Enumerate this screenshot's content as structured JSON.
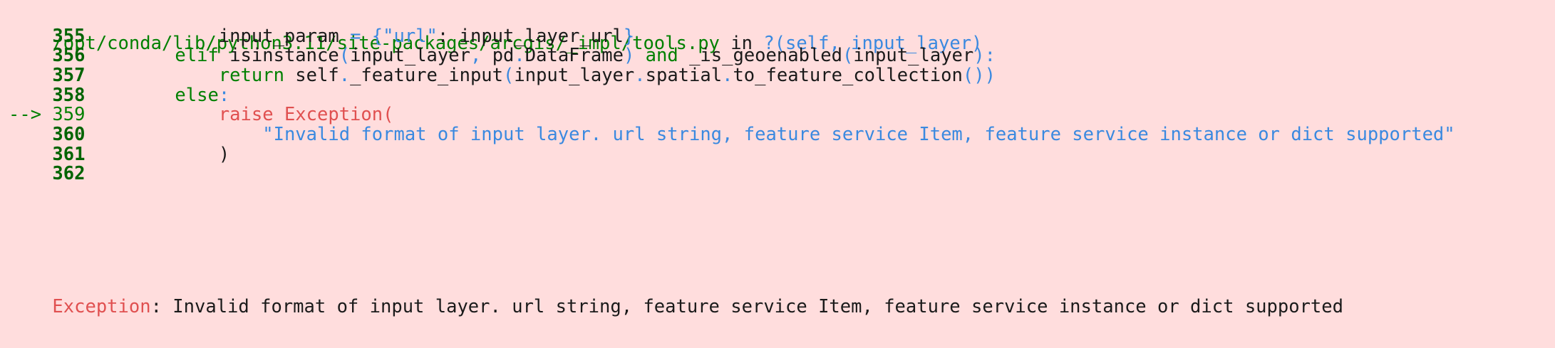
{
  "colors": {
    "background": "#ffdddd",
    "path": "#008000",
    "line_number": "#006400",
    "keyword": "#008000",
    "operator": "#3a89e0",
    "string": "#3a89e0",
    "error": "#e05050",
    "text": "#1a1a1a"
  },
  "header": {
    "path": "/opt/conda/lib/python3.11/site-packages/arcgis/_impl/tools.py",
    "in_word": " in ",
    "func_q": "?",
    "func_args": "(self, input_layer)"
  },
  "lines": [
    {
      "num": "355",
      "arrow": "",
      "indent": "        ",
      "segments": [
        {
          "t": "input_param ",
          "c": "text"
        },
        {
          "t": "=",
          "c": "operator"
        },
        {
          "t": " ",
          "c": "text"
        },
        {
          "t": "{",
          "c": "operator"
        },
        {
          "t": "\"url\"",
          "c": "string"
        },
        {
          "t": ": input_layer_url",
          "c": "text"
        },
        {
          "t": "}",
          "c": "operator"
        }
      ]
    },
    {
      "num": "356",
      "arrow": "",
      "indent": "    ",
      "segments": [
        {
          "t": "elif",
          "c": "keyword"
        },
        {
          "t": " isinstance",
          "c": "text"
        },
        {
          "t": "(",
          "c": "operator"
        },
        {
          "t": "input_layer",
          "c": "text"
        },
        {
          "t": ",",
          "c": "operator"
        },
        {
          "t": " pd",
          "c": "text"
        },
        {
          "t": ".",
          "c": "operator"
        },
        {
          "t": "DataFrame",
          "c": "text"
        },
        {
          "t": ")",
          "c": "operator"
        },
        {
          "t": " ",
          "c": "text"
        },
        {
          "t": "and",
          "c": "keyword"
        },
        {
          "t": " _is_geoenabled",
          "c": "text"
        },
        {
          "t": "(",
          "c": "operator"
        },
        {
          "t": "input_layer",
          "c": "text"
        },
        {
          "t": "):",
          "c": "operator"
        }
      ]
    },
    {
      "num": "357",
      "arrow": "",
      "indent": "        ",
      "segments": [
        {
          "t": "return",
          "c": "keyword"
        },
        {
          "t": " self",
          "c": "text"
        },
        {
          "t": ".",
          "c": "operator"
        },
        {
          "t": "_feature_input",
          "c": "text"
        },
        {
          "t": "(",
          "c": "operator"
        },
        {
          "t": "input_layer",
          "c": "text"
        },
        {
          "t": ".",
          "c": "operator"
        },
        {
          "t": "spatial",
          "c": "text"
        },
        {
          "t": ".",
          "c": "operator"
        },
        {
          "t": "to_feature_collection",
          "c": "text"
        },
        {
          "t": "())",
          "c": "operator"
        }
      ]
    },
    {
      "num": "358",
      "arrow": "",
      "indent": "    ",
      "segments": [
        {
          "t": "else",
          "c": "keyword"
        },
        {
          "t": ":",
          "c": "operator"
        }
      ]
    },
    {
      "num": "359",
      "arrow": "--> ",
      "indent": "        ",
      "segments": [
        {
          "t": "raise Exception(",
          "c": "error"
        }
      ]
    },
    {
      "num": "360",
      "arrow": "",
      "indent": "            ",
      "segments": [
        {
          "t": "\"Invalid format of input layer. url string, feature service Item, feature service instance or dict supported\"",
          "c": "string"
        }
      ]
    },
    {
      "num": "361",
      "arrow": "",
      "indent": "        ",
      "segments": [
        {
          "t": ")",
          "c": "text"
        }
      ]
    },
    {
      "num": "362",
      "arrow": "",
      "indent": "",
      "segments": []
    }
  ],
  "error": {
    "type": "Exception",
    "message": ": Invalid format of input layer. url string, feature service Item, feature service instance or dict supported"
  }
}
